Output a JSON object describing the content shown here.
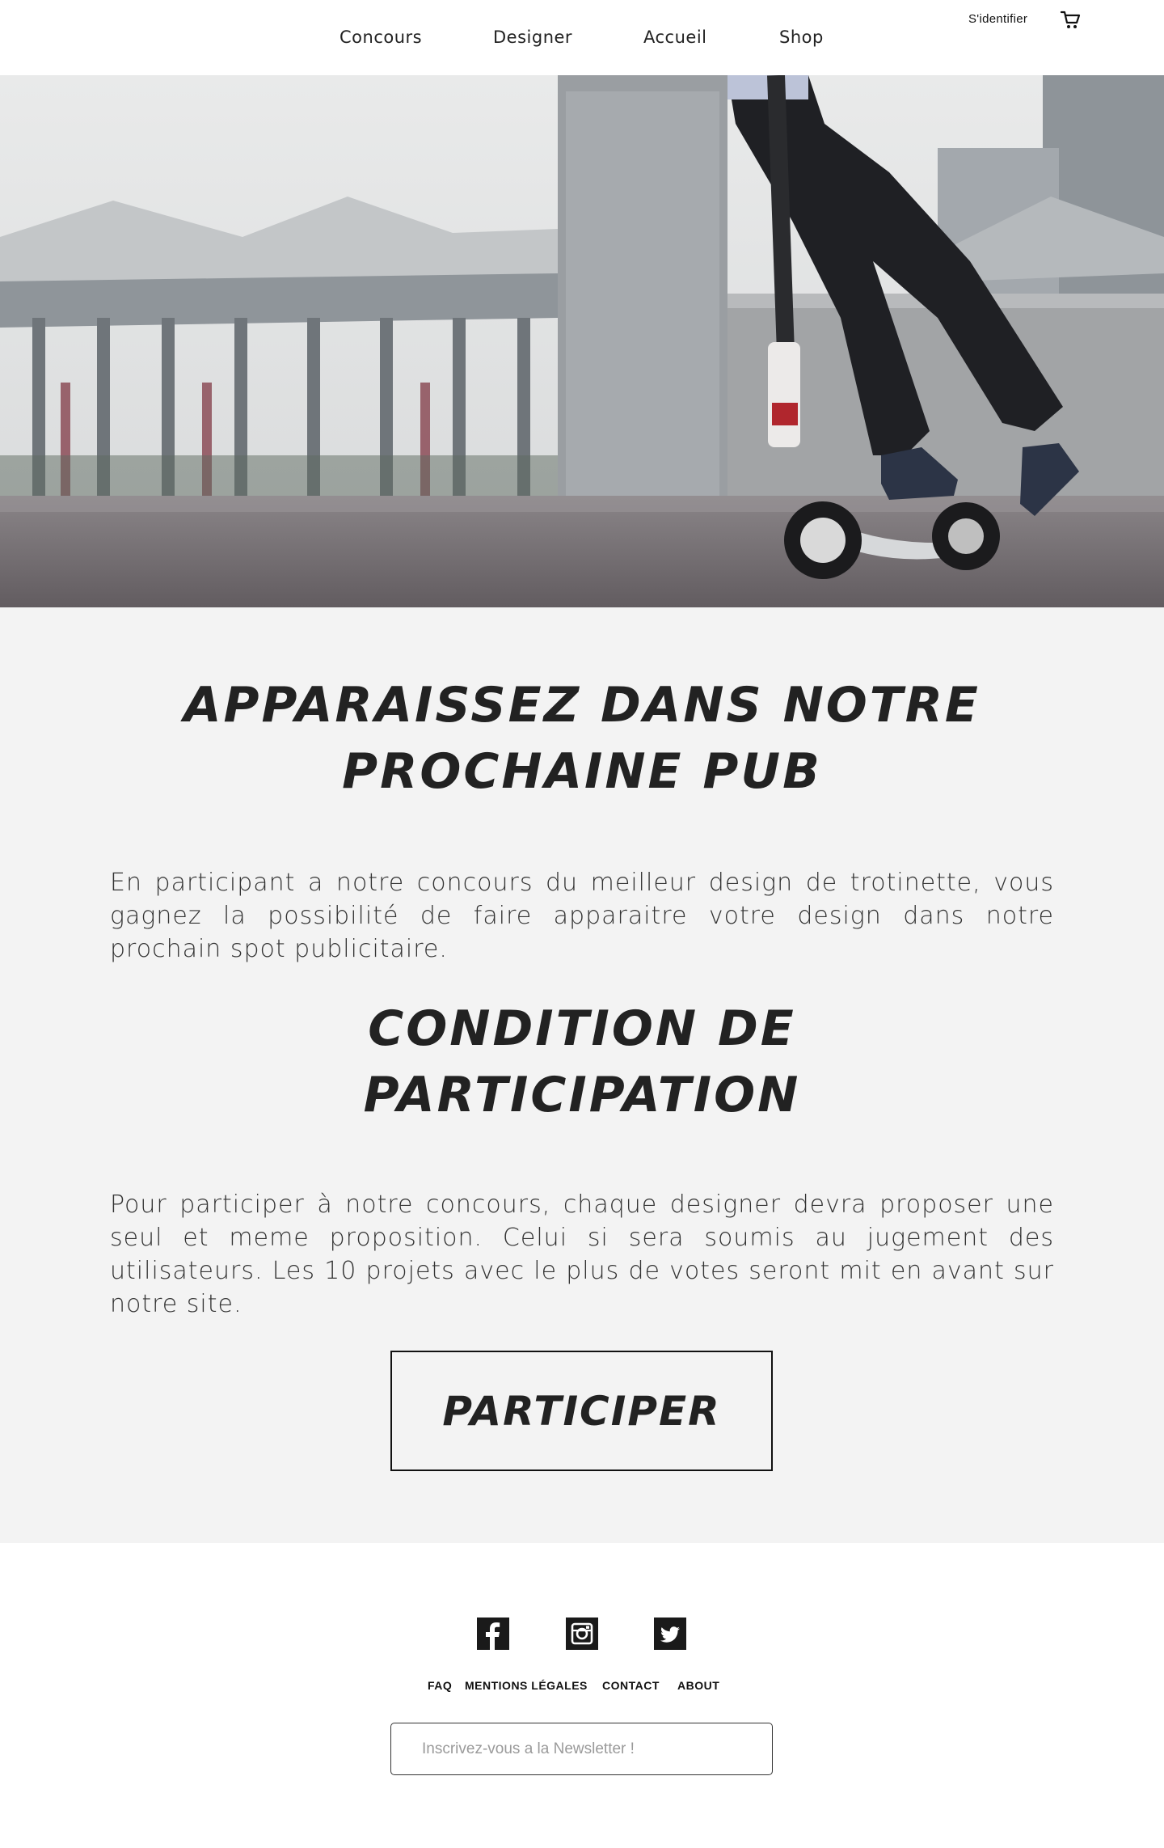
{
  "nav": {
    "items": [
      "Concours",
      "Designer",
      "Accueil",
      "Shop"
    ],
    "login_label": "S'identifier"
  },
  "hero": {
    "description": ""
  },
  "main": {
    "title": "APPARAISSEZ DANS NOTRE PROCHAINE PUB",
    "intro": "En participant a notre concours du meilleur design de trotinette, vous gagnez la possibilité de faire apparaitre votre design dans notre prochain spot publicitaire.",
    "condition_title": "CONDITION DE PARTICIPATION",
    "condition_text": "Pour participer à notre concours, chaque designer devra proposer une seul et meme proposition. Celui si sera soumis au jugement des utilisateurs. Les 10 projets avec le plus de votes seront mit en avant sur notre site.",
    "cta_label": "PARTICIPER"
  },
  "footer": {
    "social": [
      "facebook-icon",
      "instagram-icon",
      "twitter-icon"
    ],
    "links": [
      "FAQ",
      "MENTIONS LÉGALES",
      "CONTACT",
      "ABOUT"
    ],
    "newsletter_placeholder": "Inscrivez-vous a la Newsletter !"
  },
  "colors": {
    "text": "#222222",
    "content_bg": "#f3f3f3",
    "footer_bg": "#ffffff"
  }
}
